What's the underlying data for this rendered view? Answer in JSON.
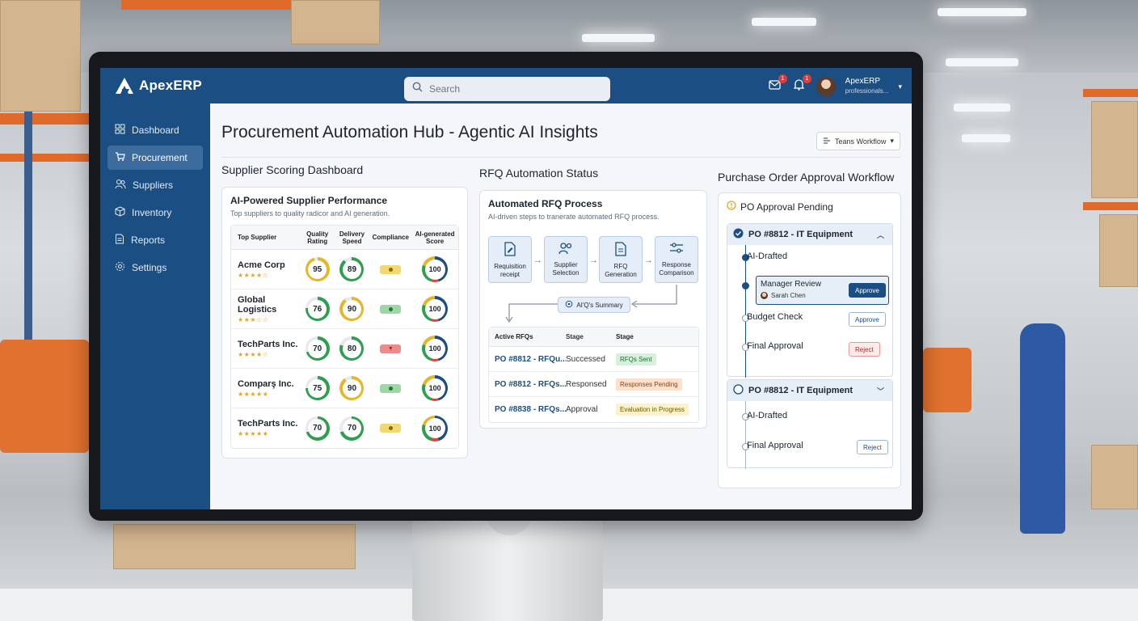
{
  "app": {
    "name": "ApexERP"
  },
  "search": {
    "placeholder": "Search"
  },
  "header": {
    "mail_badge": "1",
    "bell_badge": "1",
    "user_name": "ApexERP",
    "user_sub": "professionals..."
  },
  "sidebar": {
    "items": [
      {
        "label": "Dashboard",
        "icon": "grid-icon"
      },
      {
        "label": "Procurement",
        "icon": "cart-icon",
        "active": true
      },
      {
        "label": "Suppliers",
        "icon": "users-icon"
      },
      {
        "label": "Inventory",
        "icon": "box-icon"
      },
      {
        "label": "Reports",
        "icon": "document-icon"
      },
      {
        "label": "Settings",
        "icon": "gear-icon"
      }
    ]
  },
  "page": {
    "title": "Procurement Automation Hub - Agentic AI Insights",
    "workflow_button": "Teans Workflow"
  },
  "suppliers": {
    "section_title": "Supplier Scoring Dashboard",
    "card_title": "AI-Powered Supplier Performance",
    "card_sub": "Top suppliers to quality radicor and AI generation.",
    "columns": [
      "Top Supplier",
      "Quality Rating",
      "Delivery Speed",
      "Compliance",
      "AI-generated Score"
    ],
    "rows": [
      {
        "name": "Acme Corp",
        "stars": "★★★★☆",
        "quality": 95,
        "delivery": 89,
        "compliance": "yellow",
        "score": 100
      },
      {
        "name": "Global Logistics",
        "stars": "★★★☆☆",
        "quality": 76,
        "delivery": 90,
        "compliance": "green",
        "score": 100
      },
      {
        "name": "TechParts Inc.",
        "stars": "★★★★☆",
        "quality": 70,
        "delivery": 80,
        "compliance": "red",
        "score": 100
      },
      {
        "name": "Comparş Inc.",
        "stars": "★★★★★",
        "quality": 75,
        "delivery": 90,
        "compliance": "green",
        "score": 100
      },
      {
        "name": "TechParts Inc.",
        "stars": "★★★★★",
        "quality": 70,
        "delivery": 70,
        "compliance": "yellow",
        "score": 100
      }
    ]
  },
  "rfq": {
    "section_title": "RFQ Automation Status",
    "card_title": "Automated RFQ Process",
    "card_sub": "AI-driven steps to tranerate automated RFQ process.",
    "steps": [
      {
        "label": "Requisition receipt",
        "icon": "document-edit-icon"
      },
      {
        "label": "Supplier Selection",
        "icon": "users-icon"
      },
      {
        "label": "RFQ Generation",
        "icon": "document-icon"
      },
      {
        "label": "Response Comparison",
        "icon": "sliders-icon"
      }
    ],
    "summary": "AI'Q's Summary",
    "columns": [
      "Active RFQs",
      "Stage",
      "Stage"
    ],
    "rows": [
      {
        "id": "PO #8812 - RFQu...",
        "stage": "Successed",
        "status": "RFQs Sent",
        "tone": "green"
      },
      {
        "id": "PO #8812 - RFQs...",
        "stage": "Responsed",
        "status": "Responses Pending",
        "tone": "orange"
      },
      {
        "id": "PO #8838 - RFQs...",
        "stage": "Approval",
        "status": "Evaluation in Progress",
        "tone": "yellow"
      }
    ]
  },
  "po": {
    "section_title": "Purchase Order Approval Workflow",
    "card_title": "PO Approval Pending",
    "groups": [
      {
        "title": "PO #8812 - IT Equipment",
        "steps": [
          {
            "label": "AI-Drafted"
          },
          {
            "label": "Manager Review",
            "person": "Sarah Chen",
            "action": "Approve"
          },
          {
            "label": "Budget Check",
            "action": "Approve"
          },
          {
            "label": "Final Approval",
            "action": "Reject"
          }
        ]
      },
      {
        "title": "PO #8812 - IT Equipment",
        "steps": [
          {
            "label": "AI-Drafted"
          },
          {
            "label": "Final Approval",
            "action": "Reject"
          }
        ]
      }
    ]
  },
  "colors": {
    "brand": "#1b4e83",
    "ring_green": "#2e9e4f",
    "ring_yellow": "#e6b626",
    "ring_blue": "#1b4e83",
    "ring_red": "#d9483b"
  }
}
